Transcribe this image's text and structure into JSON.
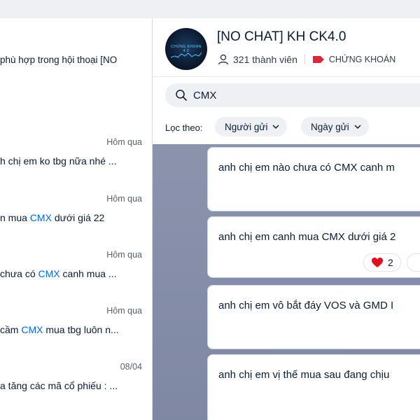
{
  "left_panel": {
    "intro_text": "phù hợp trong hội thoại [NO",
    "results": [
      {
        "time": "Hôm qua",
        "before": "h chị em ko tbg nữa nhé ...",
        "highlight": "",
        "after": ""
      },
      {
        "time": "Hôm qua",
        "before": "n mua ",
        "highlight": "CMX",
        "after": " dưới giá 22"
      },
      {
        "time": "Hôm qua",
        "before": " chưa có ",
        "highlight": "CMX",
        "after": " canh mua ..."
      },
      {
        "time": "Hôm qua",
        "before": " cầm ",
        "highlight": "CMX",
        "after": " mua tbg luôn n..."
      },
      {
        "time": "08/04",
        "before": "a tăng các mã cổ phiếu : ...",
        "highlight": "",
        "after": ""
      }
    ]
  },
  "conversation": {
    "avatar_text_1": "CHỨNG KHOÁN",
    "avatar_text_2": "4.0",
    "title": "[NO CHAT] KH CK4.0",
    "member_count": "321 thành viên",
    "tag_label": "CHỨNG KHOÁN",
    "tag_color": "#e0263b",
    "search_value": "CMX",
    "filter_label": "Lọc theo:",
    "filter_sender": "Người gửi",
    "filter_date": "Ngày gửi",
    "messages": [
      {
        "text": "anh chị em nào chưa có CMX canh m"
      },
      {
        "text": "anh chị em canh mua CMX dưới giá 2",
        "reaction_emoji": "heart",
        "reaction_count": "2"
      },
      {
        "text": "anh chị em vô bắt đáy VOS và GMD I"
      },
      {
        "text": "anh chị em vị thế mua sau đang chịu"
      }
    ],
    "accent_color": "#0068ff"
  }
}
